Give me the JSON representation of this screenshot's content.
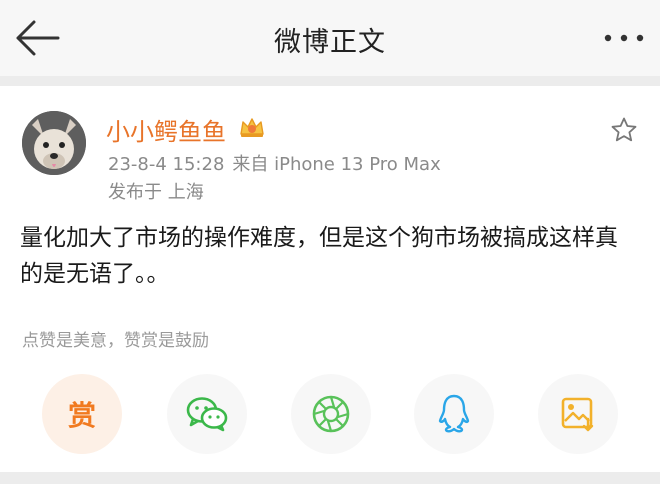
{
  "nav": {
    "title": "微博正文",
    "back_icon": "back-arrow-icon",
    "more_icon": "more-dots-icon"
  },
  "post": {
    "author": "小小鳄鱼鱼",
    "badge_icon": "crown-icon",
    "time": "23-8-4 15:28",
    "source": "来自 iPhone 13 Pro Max",
    "location": "发布于 上海",
    "text": "量化加大了市场的操作难度，但是这个狗市场被搞成这样真的是无语了。。",
    "favorite_icon": "star-icon"
  },
  "reward": {
    "tip": "点赞是美意，赞赏是鼓励",
    "button_label": "赏"
  },
  "share": {
    "items": [
      "wechat-icon",
      "moments-icon",
      "qq-icon",
      "save-image-icon"
    ]
  },
  "colors": {
    "accent": "#e8742a",
    "reward": "#f17a20",
    "wechat": "#3bb84a",
    "moments": "#59c25a",
    "qq": "#2aa6e8",
    "save": "#f2b12b"
  }
}
